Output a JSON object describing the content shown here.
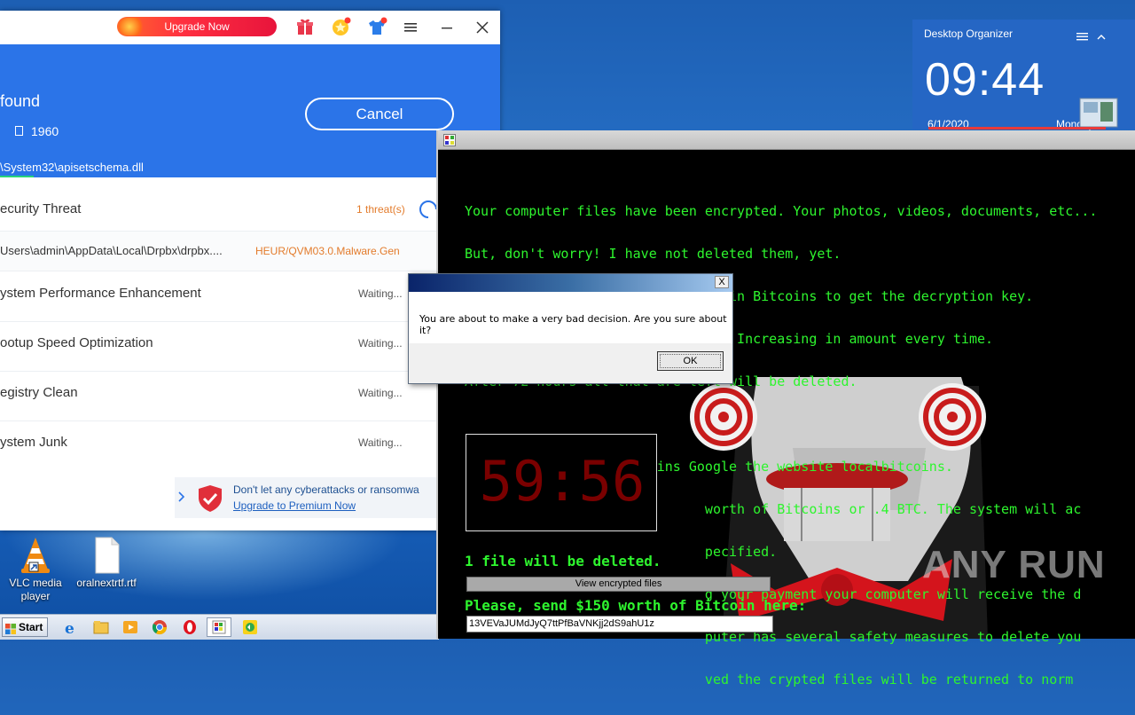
{
  "security_app": {
    "upgrade_label": "Upgrade Now",
    "header": {
      "found_text": "found",
      "file_count": "1960",
      "cancel_label": "Cancel",
      "scan_path": "\\System32\\apisetschema.dll"
    },
    "rows": [
      {
        "label": "ecurity Threat",
        "value": "1 threat(s)"
      },
      {
        "label": "Users\\admin\\AppData\\Local\\Drpbx\\drpbx....",
        "value": "HEUR/QVM03.0.Malware.Gen"
      },
      {
        "label": "ystem Performance Enhancement",
        "value": "Waiting..."
      },
      {
        "label": "ootup Speed Optimization",
        "value": "Waiting..."
      },
      {
        "label": "egistry Clean",
        "value": "Waiting..."
      },
      {
        "label": "ystem Junk",
        "value": "Waiting..."
      }
    ],
    "promo": {
      "text": "Don't let any cyberattacks or ransomwa",
      "link": "Upgrade to Premium Now"
    }
  },
  "organizer": {
    "title": "Desktop Organizer",
    "time": "09:44",
    "date": "6/1/2020",
    "day": "Monday"
  },
  "ransom": {
    "lines": [
      "Your computer files have been encrypted. Your photos, videos, documents, etc...",
      "But, don't worry! I have not deleted them, yet.",
      "You have 24 hours to pay 150 USD in Bitcoins to get the decryption key.",
      "Every hour files will be deleted. Increasing in amount every time.",
      "After 72 hours all that are left will be deleted.",
      "",
      "If you do not have bitcoins Google the website localbitcoins.",
      "                              worth of Bitcoins or .4 BTC. The system will ac",
      "                              pecified.",
      "                              g your payment your computer will receive the d",
      "                              puter has several safety measures to delete you",
      "                              ved the crypted files will be returned to norm"
    ],
    "timer": "59:56",
    "will_delete": "1 file will be deleted.",
    "view_button": "View encrypted files",
    "send_text": "Please, send $150 worth of Bitcoin here:",
    "address": "13VEVaJUMdJyQ7ttPfBaVNKjj2dS9ahU1z"
  },
  "dialog": {
    "message": "You are about to make a very bad decision. Are you sure about it?",
    "ok_label": "OK",
    "close_label": "X"
  },
  "desktop": {
    "icons": [
      {
        "label": "VLC media player"
      },
      {
        "label": "oralnextrtf.rtf"
      }
    ]
  },
  "taskbar": {
    "start_label": "Start"
  },
  "watermark": "ANY RUN",
  "colors": {
    "brand_blue": "#2b74e8",
    "upgrade_red": "#e8143c",
    "ransom_green": "#2ef52e",
    "timer_red": "#7a0000"
  }
}
